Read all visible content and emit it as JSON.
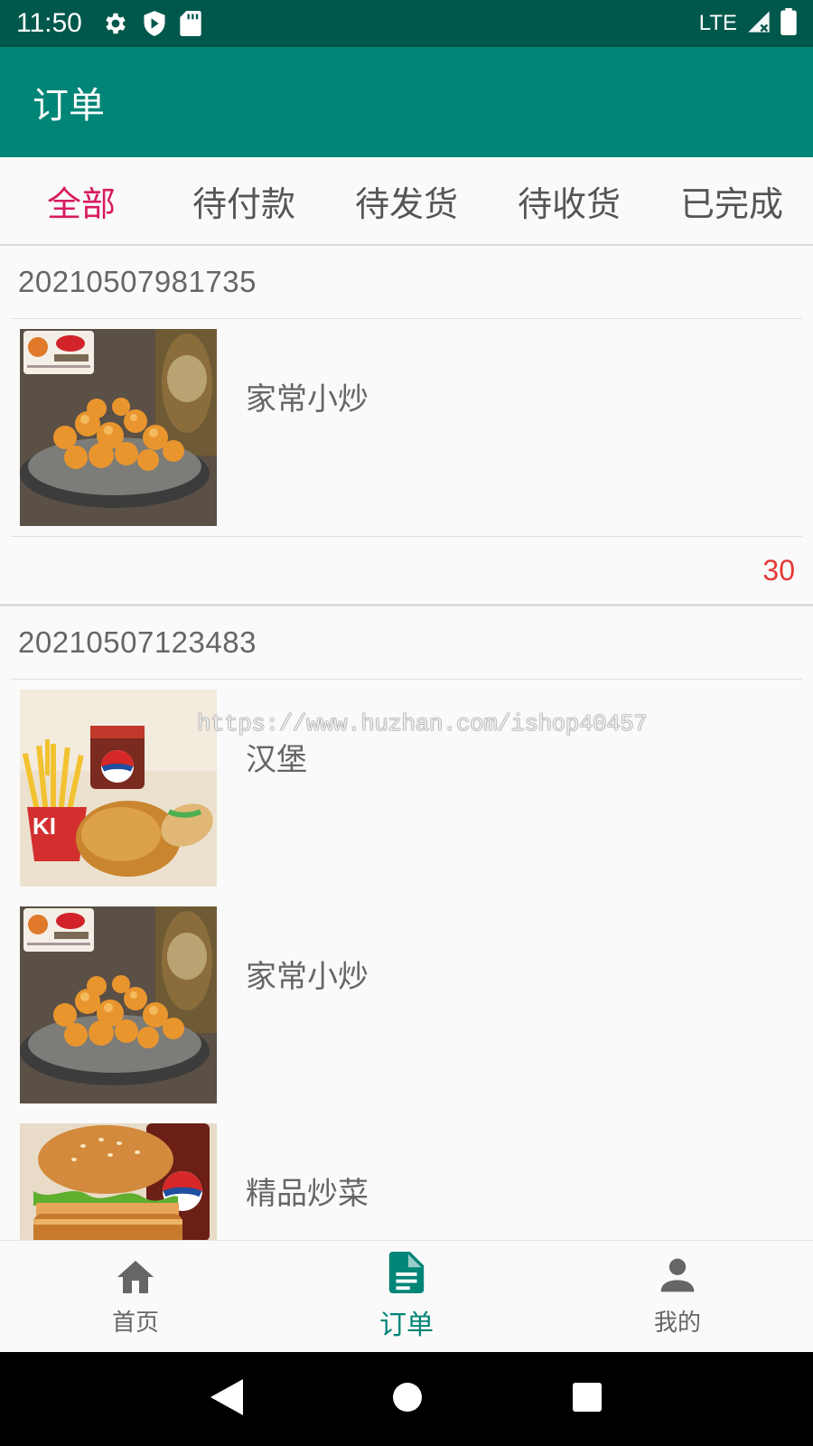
{
  "status_bar": {
    "time": "11:50",
    "network": "LTE"
  },
  "app_bar": {
    "title": "订单"
  },
  "tabs": [
    {
      "label": "全部",
      "active": true
    },
    {
      "label": "待付款",
      "active": false
    },
    {
      "label": "待发货",
      "active": false
    },
    {
      "label": "待收货",
      "active": false
    },
    {
      "label": "已完成",
      "active": false
    }
  ],
  "orders": [
    {
      "order_no": "20210507981735",
      "items": [
        {
          "name": "家常小炒",
          "image": "fried-chicken-bites-image"
        }
      ],
      "total": "30"
    },
    {
      "order_no": "20210507123483",
      "items": [
        {
          "name": "汉堡",
          "image": "kfc-meal-image"
        },
        {
          "name": "家常小炒",
          "image": "fried-chicken-bites-image"
        },
        {
          "name": "精品炒菜",
          "image": "burger-pepsi-image"
        }
      ]
    }
  ],
  "watermark": "https://www.huzhan.com/ishop40457",
  "bottom_nav": [
    {
      "label": "首页",
      "icon": "home-icon",
      "active": false
    },
    {
      "label": "订单",
      "icon": "document-icon",
      "active": true
    },
    {
      "label": "我的",
      "icon": "person-icon",
      "active": false
    }
  ],
  "colors": {
    "primary": "#008577",
    "primary_dark": "#00574b",
    "accent": "#d81b60",
    "price": "#e53935"
  }
}
